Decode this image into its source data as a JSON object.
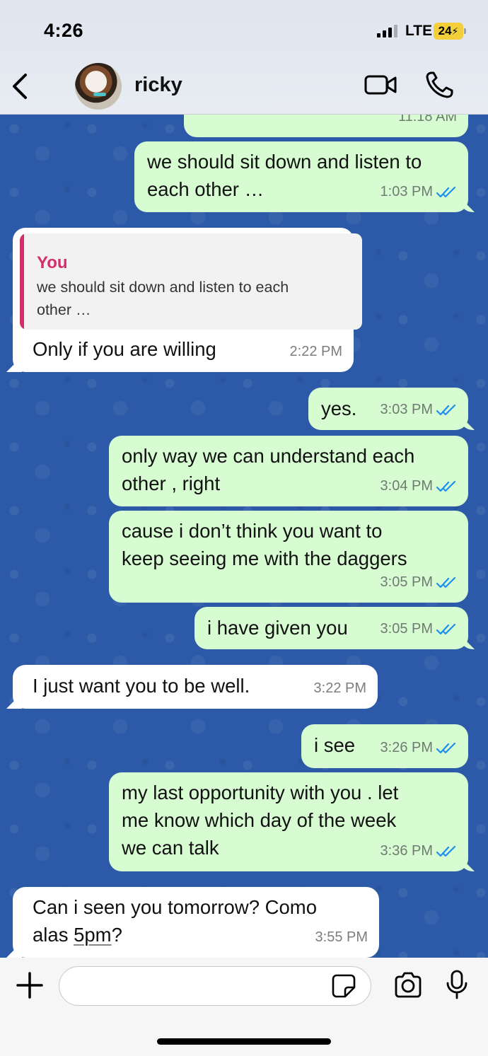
{
  "status": {
    "time": "4:26",
    "network": "LTE",
    "battery": "24"
  },
  "header": {
    "contact_name": "ricky",
    "back_icon": "chevron-left-icon",
    "video_icon": "video-camera-icon",
    "call_icon": "phone-icon"
  },
  "messages": [
    {
      "dir": "out",
      "text": "",
      "time": "11:18 AM",
      "ticks": false
    },
    {
      "dir": "out",
      "line1": "we should sit down and listen to",
      "line2": "each other …",
      "time": "1:03 PM",
      "ticks": true
    },
    {
      "dir": "in",
      "quote_author": "You",
      "quote_line1": "we should sit down and listen to each",
      "quote_line2": "other …",
      "text": "Only if you are willing",
      "time": "2:22 PM"
    },
    {
      "dir": "out",
      "text": "yes.",
      "time": "3:03 PM",
      "ticks": true
    },
    {
      "dir": "out",
      "line1": "only way we can understand each",
      "line2": "other , right",
      "time": "3:04 PM",
      "ticks": true
    },
    {
      "dir": "out",
      "line1": "cause i don’t think you want to",
      "line2": "keep seeing me with the daggers",
      "time": "3:05 PM",
      "ticks": true
    },
    {
      "dir": "out",
      "text": "i have given you",
      "time": "3:05 PM",
      "ticks": true
    },
    {
      "dir": "in",
      "text": "I just want you to be well.",
      "time": "3:22 PM"
    },
    {
      "dir": "out",
      "text": "i see",
      "time": "3:26 PM",
      "ticks": true
    },
    {
      "dir": "out",
      "line1": "my last opportunity with you . let",
      "line2": "me know which day of the week",
      "line3": "we can talk",
      "time": "3:36 PM",
      "ticks": true
    },
    {
      "dir": "in",
      "line1": "Can i seen you tomorrow? Como",
      "line2a": "alas ",
      "line2b": "5pm",
      "line2c": "?",
      "time": "3:55 PM"
    }
  ],
  "composer": {
    "placeholder": "",
    "value": ""
  },
  "colors": {
    "outgoing": "#d7fcd2",
    "incoming": "#ffffff",
    "wallpaper": "#2c5aa8",
    "read_ticks": "#1c8ff0",
    "quote_accent": "#d42e6b"
  }
}
